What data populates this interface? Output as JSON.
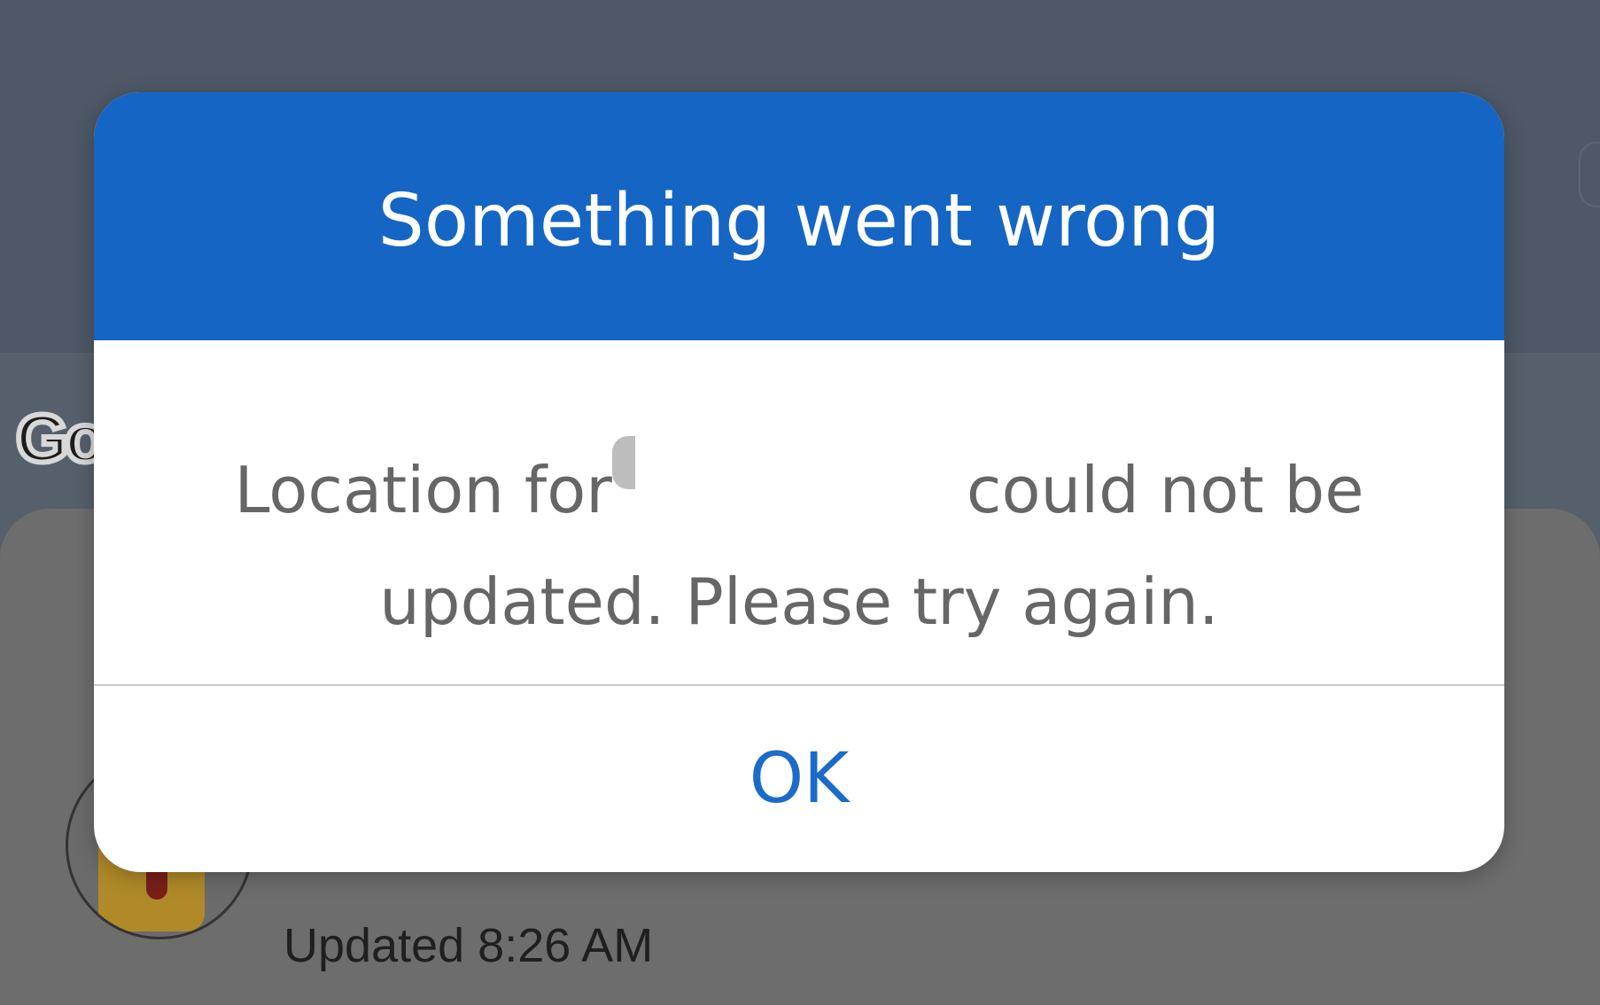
{
  "background": {
    "logo_text": "Go",
    "status_text": "Updated 8:26 AM"
  },
  "dialog": {
    "title": "Something went wrong",
    "message_prefix": "Location for",
    "message_suffix": "could not be updated. Please try again.",
    "ok_label": "OK"
  },
  "colors": {
    "header": "#1565c4",
    "ok_text": "#1b6cc8",
    "message_text": "#666666"
  }
}
